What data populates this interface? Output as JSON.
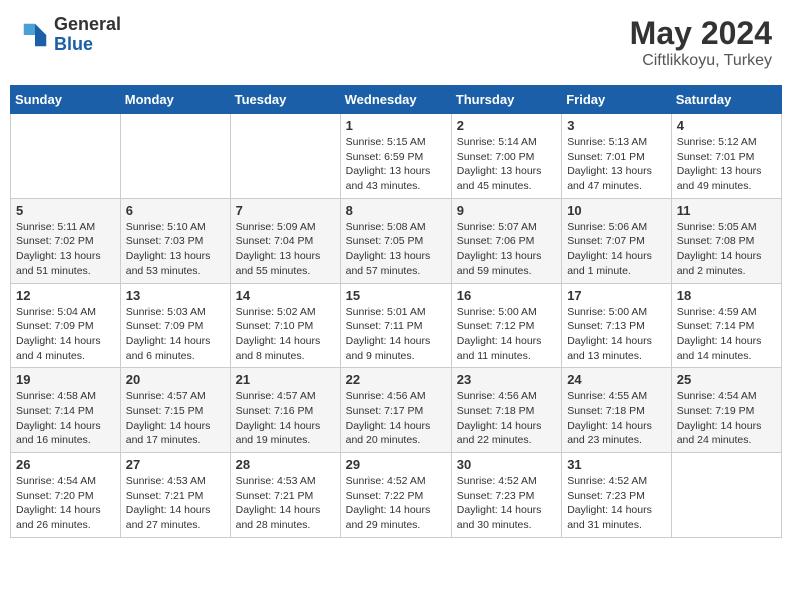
{
  "header": {
    "logo_general": "General",
    "logo_blue": "Blue",
    "month_title": "May 2024",
    "location": "Ciftlikkoyu, Turkey"
  },
  "weekdays": [
    "Sunday",
    "Monday",
    "Tuesday",
    "Wednesday",
    "Thursday",
    "Friday",
    "Saturday"
  ],
  "weeks": [
    [
      {
        "day": "",
        "sunrise": "",
        "sunset": "",
        "daylight": ""
      },
      {
        "day": "",
        "sunrise": "",
        "sunset": "",
        "daylight": ""
      },
      {
        "day": "",
        "sunrise": "",
        "sunset": "",
        "daylight": ""
      },
      {
        "day": "1",
        "sunrise": "Sunrise: 5:15 AM",
        "sunset": "Sunset: 6:59 PM",
        "daylight": "Daylight: 13 hours and 43 minutes."
      },
      {
        "day": "2",
        "sunrise": "Sunrise: 5:14 AM",
        "sunset": "Sunset: 7:00 PM",
        "daylight": "Daylight: 13 hours and 45 minutes."
      },
      {
        "day": "3",
        "sunrise": "Sunrise: 5:13 AM",
        "sunset": "Sunset: 7:01 PM",
        "daylight": "Daylight: 13 hours and 47 minutes."
      },
      {
        "day": "4",
        "sunrise": "Sunrise: 5:12 AM",
        "sunset": "Sunset: 7:01 PM",
        "daylight": "Daylight: 13 hours and 49 minutes."
      }
    ],
    [
      {
        "day": "5",
        "sunrise": "Sunrise: 5:11 AM",
        "sunset": "Sunset: 7:02 PM",
        "daylight": "Daylight: 13 hours and 51 minutes."
      },
      {
        "day": "6",
        "sunrise": "Sunrise: 5:10 AM",
        "sunset": "Sunset: 7:03 PM",
        "daylight": "Daylight: 13 hours and 53 minutes."
      },
      {
        "day": "7",
        "sunrise": "Sunrise: 5:09 AM",
        "sunset": "Sunset: 7:04 PM",
        "daylight": "Daylight: 13 hours and 55 minutes."
      },
      {
        "day": "8",
        "sunrise": "Sunrise: 5:08 AM",
        "sunset": "Sunset: 7:05 PM",
        "daylight": "Daylight: 13 hours and 57 minutes."
      },
      {
        "day": "9",
        "sunrise": "Sunrise: 5:07 AM",
        "sunset": "Sunset: 7:06 PM",
        "daylight": "Daylight: 13 hours and 59 minutes."
      },
      {
        "day": "10",
        "sunrise": "Sunrise: 5:06 AM",
        "sunset": "Sunset: 7:07 PM",
        "daylight": "Daylight: 14 hours and 1 minute."
      },
      {
        "day": "11",
        "sunrise": "Sunrise: 5:05 AM",
        "sunset": "Sunset: 7:08 PM",
        "daylight": "Daylight: 14 hours and 2 minutes."
      }
    ],
    [
      {
        "day": "12",
        "sunrise": "Sunrise: 5:04 AM",
        "sunset": "Sunset: 7:09 PM",
        "daylight": "Daylight: 14 hours and 4 minutes."
      },
      {
        "day": "13",
        "sunrise": "Sunrise: 5:03 AM",
        "sunset": "Sunset: 7:09 PM",
        "daylight": "Daylight: 14 hours and 6 minutes."
      },
      {
        "day": "14",
        "sunrise": "Sunrise: 5:02 AM",
        "sunset": "Sunset: 7:10 PM",
        "daylight": "Daylight: 14 hours and 8 minutes."
      },
      {
        "day": "15",
        "sunrise": "Sunrise: 5:01 AM",
        "sunset": "Sunset: 7:11 PM",
        "daylight": "Daylight: 14 hours and 9 minutes."
      },
      {
        "day": "16",
        "sunrise": "Sunrise: 5:00 AM",
        "sunset": "Sunset: 7:12 PM",
        "daylight": "Daylight: 14 hours and 11 minutes."
      },
      {
        "day": "17",
        "sunrise": "Sunrise: 5:00 AM",
        "sunset": "Sunset: 7:13 PM",
        "daylight": "Daylight: 14 hours and 13 minutes."
      },
      {
        "day": "18",
        "sunrise": "Sunrise: 4:59 AM",
        "sunset": "Sunset: 7:14 PM",
        "daylight": "Daylight: 14 hours and 14 minutes."
      }
    ],
    [
      {
        "day": "19",
        "sunrise": "Sunrise: 4:58 AM",
        "sunset": "Sunset: 7:14 PM",
        "daylight": "Daylight: 14 hours and 16 minutes."
      },
      {
        "day": "20",
        "sunrise": "Sunrise: 4:57 AM",
        "sunset": "Sunset: 7:15 PM",
        "daylight": "Daylight: 14 hours and 17 minutes."
      },
      {
        "day": "21",
        "sunrise": "Sunrise: 4:57 AM",
        "sunset": "Sunset: 7:16 PM",
        "daylight": "Daylight: 14 hours and 19 minutes."
      },
      {
        "day": "22",
        "sunrise": "Sunrise: 4:56 AM",
        "sunset": "Sunset: 7:17 PM",
        "daylight": "Daylight: 14 hours and 20 minutes."
      },
      {
        "day": "23",
        "sunrise": "Sunrise: 4:56 AM",
        "sunset": "Sunset: 7:18 PM",
        "daylight": "Daylight: 14 hours and 22 minutes."
      },
      {
        "day": "24",
        "sunrise": "Sunrise: 4:55 AM",
        "sunset": "Sunset: 7:18 PM",
        "daylight": "Daylight: 14 hours and 23 minutes."
      },
      {
        "day": "25",
        "sunrise": "Sunrise: 4:54 AM",
        "sunset": "Sunset: 7:19 PM",
        "daylight": "Daylight: 14 hours and 24 minutes."
      }
    ],
    [
      {
        "day": "26",
        "sunrise": "Sunrise: 4:54 AM",
        "sunset": "Sunset: 7:20 PM",
        "daylight": "Daylight: 14 hours and 26 minutes."
      },
      {
        "day": "27",
        "sunrise": "Sunrise: 4:53 AM",
        "sunset": "Sunset: 7:21 PM",
        "daylight": "Daylight: 14 hours and 27 minutes."
      },
      {
        "day": "28",
        "sunrise": "Sunrise: 4:53 AM",
        "sunset": "Sunset: 7:21 PM",
        "daylight": "Daylight: 14 hours and 28 minutes."
      },
      {
        "day": "29",
        "sunrise": "Sunrise: 4:52 AM",
        "sunset": "Sunset: 7:22 PM",
        "daylight": "Daylight: 14 hours and 29 minutes."
      },
      {
        "day": "30",
        "sunrise": "Sunrise: 4:52 AM",
        "sunset": "Sunset: 7:23 PM",
        "daylight": "Daylight: 14 hours and 30 minutes."
      },
      {
        "day": "31",
        "sunrise": "Sunrise: 4:52 AM",
        "sunset": "Sunset: 7:23 PM",
        "daylight": "Daylight: 14 hours and 31 minutes."
      },
      {
        "day": "",
        "sunrise": "",
        "sunset": "",
        "daylight": ""
      }
    ]
  ]
}
